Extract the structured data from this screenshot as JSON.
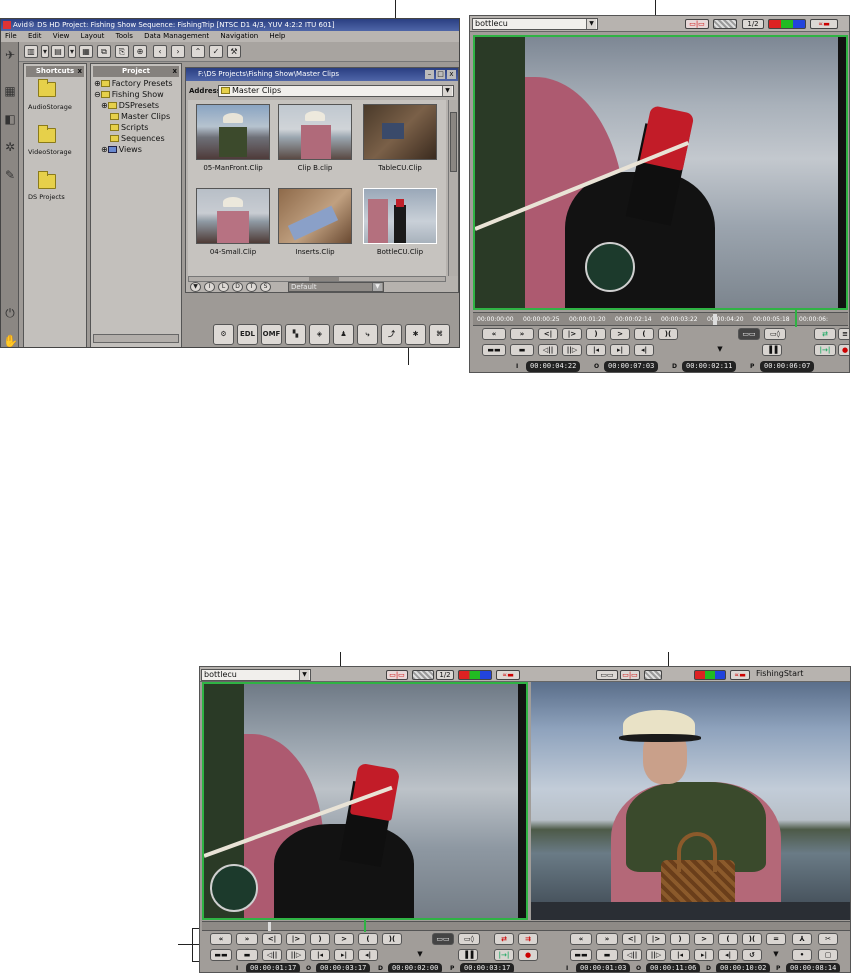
{
  "app": {
    "title": "Avid® DS HD Project: Fishing Show   Sequence: FishingTrip   [NTSC D1 4/3, YUV 4:2:2 ITU 601]",
    "menu": [
      "File",
      "Edit",
      "View",
      "Layout",
      "Tools",
      "Data Management",
      "Navigation",
      "Help"
    ]
  },
  "shortcuts": {
    "title": "Shortcuts",
    "items": [
      "AudioStorage",
      "VideoStorage",
      "DS Projects"
    ]
  },
  "project": {
    "title": "Project",
    "tree": [
      "Factory Presets",
      "Fishing Show",
      "DSPresets",
      "Master Clips",
      "Scripts",
      "Sequences",
      "Views"
    ]
  },
  "browser": {
    "title": "F:\\DS Projects\\Fishing Show\\Master Clips",
    "address_label": "Address",
    "address_value": "Master Clips",
    "clips": [
      "05-ManFront.Clip",
      "Clip B.clip",
      "TableCU.Clip",
      "04-Small.Clip",
      "Inserts.Clip",
      "BottleCU.Clip"
    ],
    "footer_buttons": [
      "I",
      "L",
      "D",
      "T",
      "S"
    ],
    "view_select": "Default"
  },
  "bottom_toolbar": [
    "EDL",
    "OMF"
  ],
  "viewer1": {
    "clip": "bottlecu",
    "half": "1/2",
    "timeline_ticks": [
      "00:00:00:00",
      "00:00:00:25",
      "00:00:01:20",
      "00:00:02:14",
      "00:00:03:22",
      "00:00:04:20",
      "00:00:05:18",
      "00:00:06:"
    ],
    "timecodes": [
      {
        "label": "I",
        "value": "00:00:04:22"
      },
      {
        "label": "O",
        "value": "00:00:07:03"
      },
      {
        "label": "D",
        "value": "00:00:02:11"
      },
      {
        "label": "P",
        "value": "00:00:06:07"
      }
    ]
  },
  "viewer2": {
    "clip_left": "bottlecu",
    "half": "1/2",
    "clip_right": "FishingStart",
    "timecodes_left": [
      {
        "label": "I",
        "value": "00:00:01:17"
      },
      {
        "label": "O",
        "value": "00:00:03:17"
      },
      {
        "label": "D",
        "value": "00:00:02:00"
      },
      {
        "label": "P",
        "value": "00:00:03:17"
      }
    ],
    "timecodes_right": [
      {
        "label": "I",
        "value": "00:00:01:03"
      },
      {
        "label": "O",
        "value": "00:00:11:06"
      },
      {
        "label": "D",
        "value": "00:00:10:02"
      },
      {
        "label": "P",
        "value": "00:00:08:14"
      }
    ]
  },
  "colors": {
    "accent_green": "#2fb344",
    "titlebar": "#2a3f82",
    "window_bg": "#9e9a96"
  }
}
